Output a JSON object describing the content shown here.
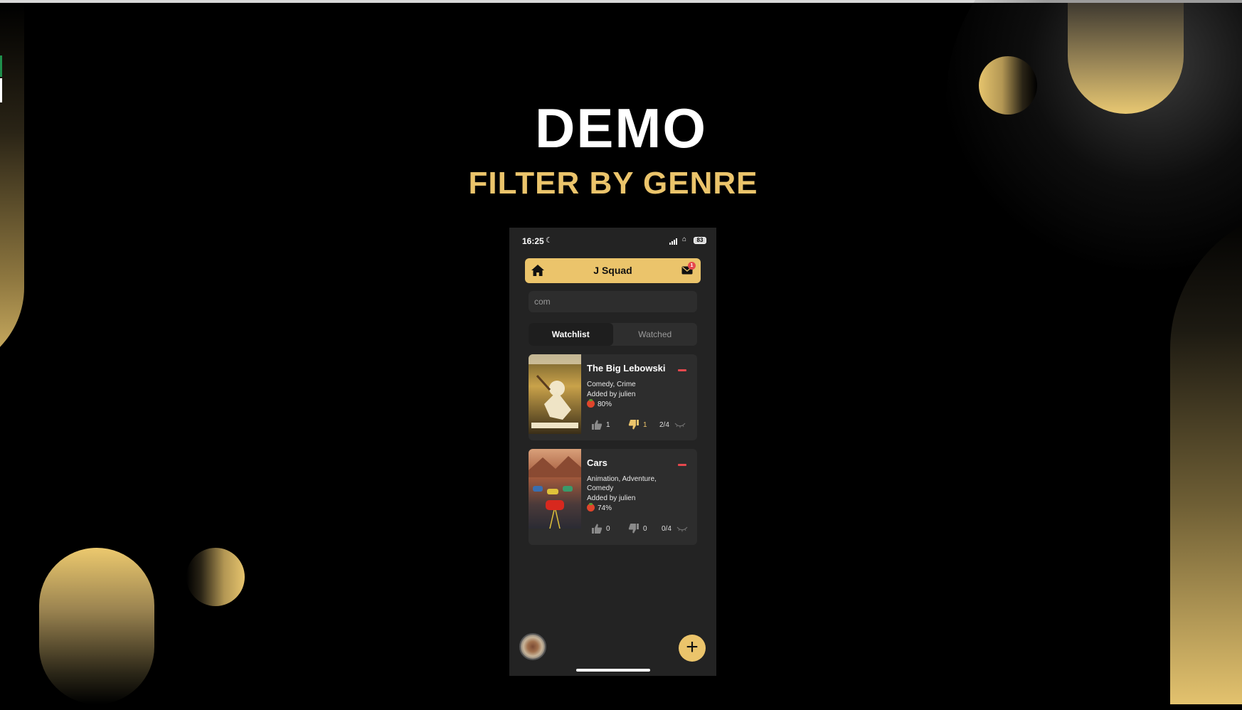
{
  "slide": {
    "title": "DEMO",
    "subtitle": "FILTER BY GENRE",
    "colors": {
      "gold": "#ebc46b",
      "background": "#000000"
    }
  },
  "phone": {
    "status_bar": {
      "time": "16:25",
      "battery": "83"
    },
    "header": {
      "title": "J Squad",
      "home_icon": "home-icon",
      "mail_icon": "mail-icon",
      "notification_count": "1"
    },
    "search": {
      "value": "com",
      "placeholder": ""
    },
    "tabs": [
      {
        "label": "Watchlist",
        "active": true
      },
      {
        "label": "Watched",
        "active": false
      }
    ],
    "movies": [
      {
        "title": "The Big Lebowski",
        "genres": "Comedy, Crime",
        "added_by": "Added by julien",
        "rating": "80%",
        "likes": "1",
        "dislikes": "1",
        "progress": "2/4"
      },
      {
        "title": "Cars",
        "genres": "Animation, Adventure, Comedy",
        "added_by": "Added by julien",
        "rating": "74%",
        "likes": "0",
        "dislikes": "0",
        "progress": "0/4"
      }
    ],
    "fab_label": "+"
  }
}
